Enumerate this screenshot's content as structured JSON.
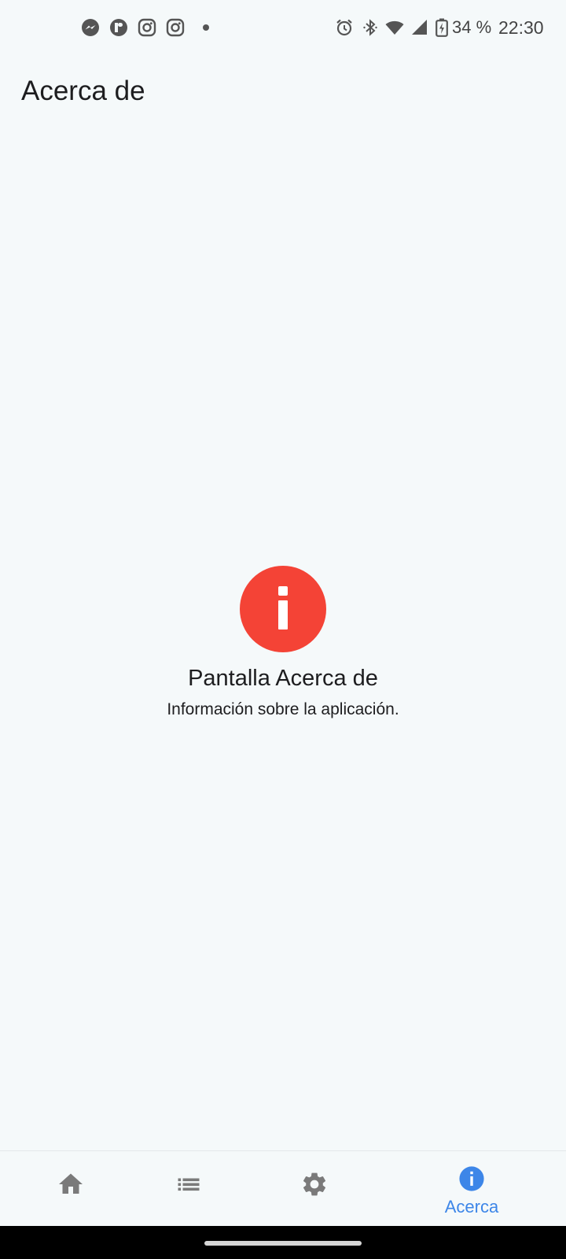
{
  "status_bar": {
    "notification_icons": [
      "messenger-icon",
      "flipboard-icon",
      "instagram-icon",
      "instagram-icon",
      "more-notifications-dot"
    ],
    "system_icons": [
      "alarm-icon",
      "bluetooth-icon",
      "wifi-icon",
      "cellular-signal-icon",
      "battery-charging-icon"
    ],
    "battery": "34 %",
    "time": "22:30"
  },
  "app_bar": {
    "title": "Acerca de"
  },
  "content": {
    "icon": "info-icon",
    "icon_color": "#F44336",
    "title": "Pantalla Acerca de",
    "subtitle": "Información sobre la aplicación."
  },
  "bottom_nav": {
    "active_color": "#3D86E8",
    "inactive_color": "#757575",
    "items": [
      {
        "icon": "home-icon",
        "label": "",
        "active": false
      },
      {
        "icon": "list-icon",
        "label": "",
        "active": false
      },
      {
        "icon": "settings-icon",
        "label": "",
        "active": false
      },
      {
        "icon": "info-icon",
        "label": "Acerca",
        "active": true
      }
    ]
  }
}
